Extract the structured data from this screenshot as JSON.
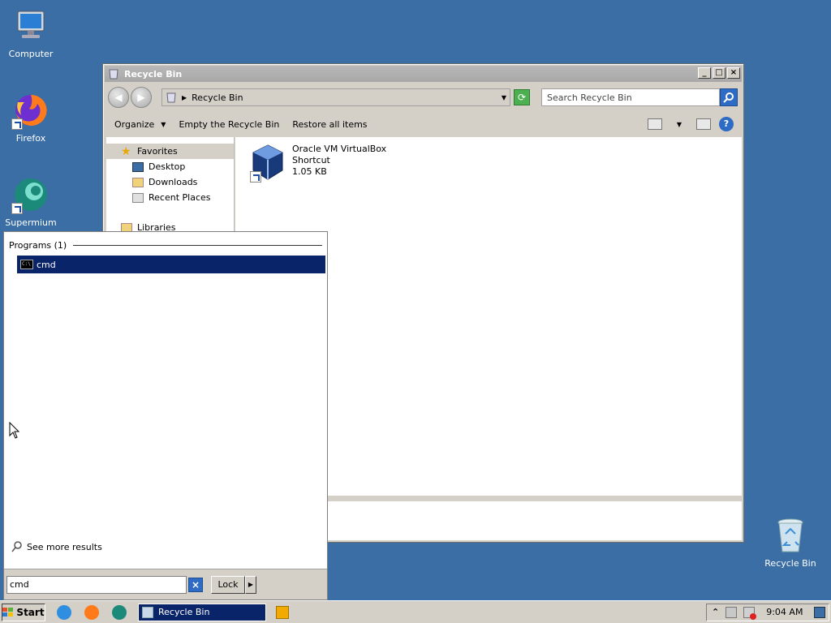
{
  "desktop": {
    "icons": [
      {
        "label": "Computer",
        "icon": "computer-icon"
      },
      {
        "label": "Firefox",
        "icon": "firefox-icon"
      },
      {
        "label": "Supermium",
        "icon": "supermium-icon"
      },
      {
        "label": "Recycle Bin",
        "icon": "recycle-bin-icon"
      }
    ]
  },
  "window": {
    "title": "Recycle Bin",
    "minimize": "_",
    "maximize": "□",
    "close": "×",
    "address": "Recycle Bin",
    "search_placeholder": "Search Recycle Bin",
    "commands": {
      "organize": "Organize",
      "empty": "Empty the Recycle Bin",
      "restore": "Restore all items"
    },
    "help_label": "?",
    "nav": {
      "favorites": "Favorites",
      "items": [
        "Desktop",
        "Downloads",
        "Recent Places"
      ],
      "libraries": "Libraries"
    },
    "file": {
      "name": "Oracle VM VirtualBox",
      "type": "Shortcut",
      "size": "1.05 KB"
    }
  },
  "start_menu": {
    "group_header": "Programs (1)",
    "result": "cmd",
    "see_more": "See more results",
    "search_value": "cmd",
    "clear_label": "×",
    "lock_label": "Lock"
  },
  "taskbar": {
    "start_label": "Start",
    "active_task": "Recycle Bin",
    "clock": "9:04 AM",
    "tray_expand": "⌃"
  },
  "colors": {
    "desktop": "#3a6ea5",
    "selection": "#0a246a",
    "chrome": "#d4d0c8"
  }
}
